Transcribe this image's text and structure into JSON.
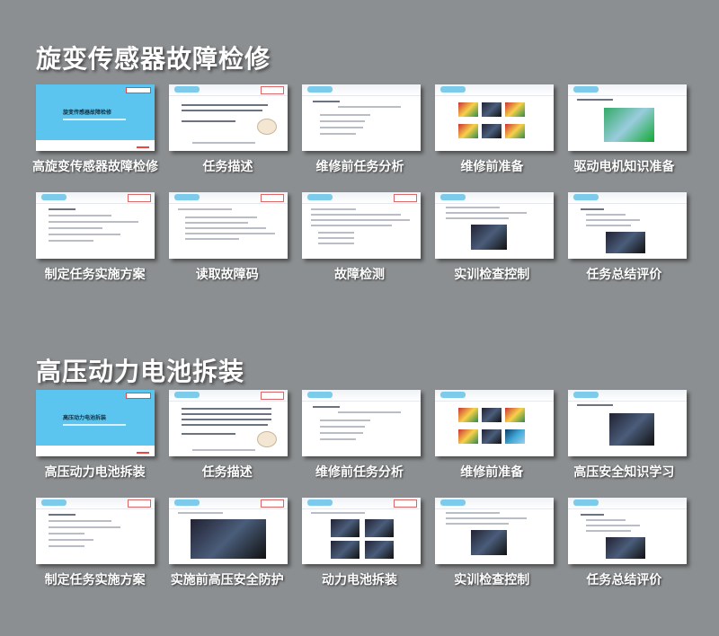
{
  "sections": [
    {
      "title": "旋变传感器故障检修",
      "slides": [
        {
          "caption": "高旋变传感器故障检修"
        },
        {
          "caption": "任务描述"
        },
        {
          "caption": "维修前任务分析"
        },
        {
          "caption": "维修前准备"
        },
        {
          "caption": "驱动电机知识准备"
        },
        {
          "caption": "制定任务实施方案"
        },
        {
          "caption": "读取故障码"
        },
        {
          "caption": "故障检测"
        },
        {
          "caption": "实训检查控制"
        },
        {
          "caption": "任务总结评价"
        }
      ]
    },
    {
      "title": "高压动力电池拆装",
      "slides": [
        {
          "caption": "高压动力电池拆装"
        },
        {
          "caption": "任务描述"
        },
        {
          "caption": "维修前任务分析"
        },
        {
          "caption": "维修前准备"
        },
        {
          "caption": "高压安全知识学习"
        },
        {
          "caption": "制定任务实施方案"
        },
        {
          "caption": "实施前高压安全防护"
        },
        {
          "caption": "动力电池拆装"
        },
        {
          "caption": "实训检查控制"
        },
        {
          "caption": "任务总结评价"
        }
      ]
    }
  ],
  "covers": [
    {
      "title": "旋变传感器故障检修"
    },
    {
      "title": "高压动力电池拆装"
    }
  ]
}
